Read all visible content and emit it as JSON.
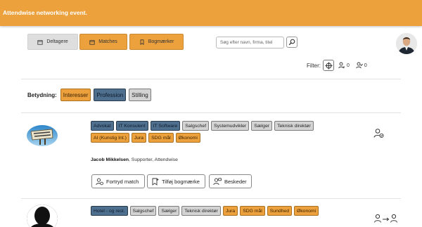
{
  "header": {
    "title": "Attendwise networking event."
  },
  "nav": {
    "participants": "Deltagere",
    "matches": "Matches",
    "bookmarks": "Bogmærker"
  },
  "search": {
    "placeholder": "Søg efter navn, firma, titel"
  },
  "filter": {
    "label": "Filter:",
    "count_a": "0",
    "count_b": "0"
  },
  "legend": {
    "label": "Betydning:",
    "items": [
      "Interesser",
      "Profession",
      "Stilling"
    ]
  },
  "colors": {
    "accent": "#eca13c",
    "profession": "#4f6f8f",
    "position": "#d3d3d3"
  },
  "people": [
    {
      "tags": [
        {
          "text": "Advokat",
          "kind": "blue"
        },
        {
          "text": "IT Konsulent",
          "kind": "blue"
        },
        {
          "text": "IT Software",
          "kind": "blue"
        },
        {
          "text": "Salgschef",
          "kind": "gray"
        },
        {
          "text": "Systemudvikler",
          "kind": "gray"
        },
        {
          "text": "Sælger",
          "kind": "gray"
        },
        {
          "text": "Teknisk direktør",
          "kind": "gray"
        },
        {
          "text": "AI (Kunstig Int.)",
          "kind": "orange"
        },
        {
          "text": "Jura",
          "kind": "orange"
        },
        {
          "text": "SDG mål",
          "kind": "orange"
        },
        {
          "text": "Økonomi",
          "kind": "orange"
        }
      ],
      "name": "Jacob Mikkelsen",
      "role": ", Supporter, Attendwise",
      "actions": [
        "Fortryd match",
        "Tilføj bogmærke",
        "Beskeder"
      ]
    },
    {
      "tags": [
        {
          "text": "Hotel - og rest.",
          "kind": "blue"
        },
        {
          "text": "Salgschef",
          "kind": "gray"
        },
        {
          "text": "Sælger",
          "kind": "gray"
        },
        {
          "text": "Teknisk direktør",
          "kind": "gray"
        },
        {
          "text": "Jura",
          "kind": "orange"
        },
        {
          "text": "SDG mål",
          "kind": "orange"
        },
        {
          "text": "Sundhed",
          "kind": "orange"
        },
        {
          "text": "Økonomi",
          "kind": "orange"
        }
      ]
    }
  ]
}
